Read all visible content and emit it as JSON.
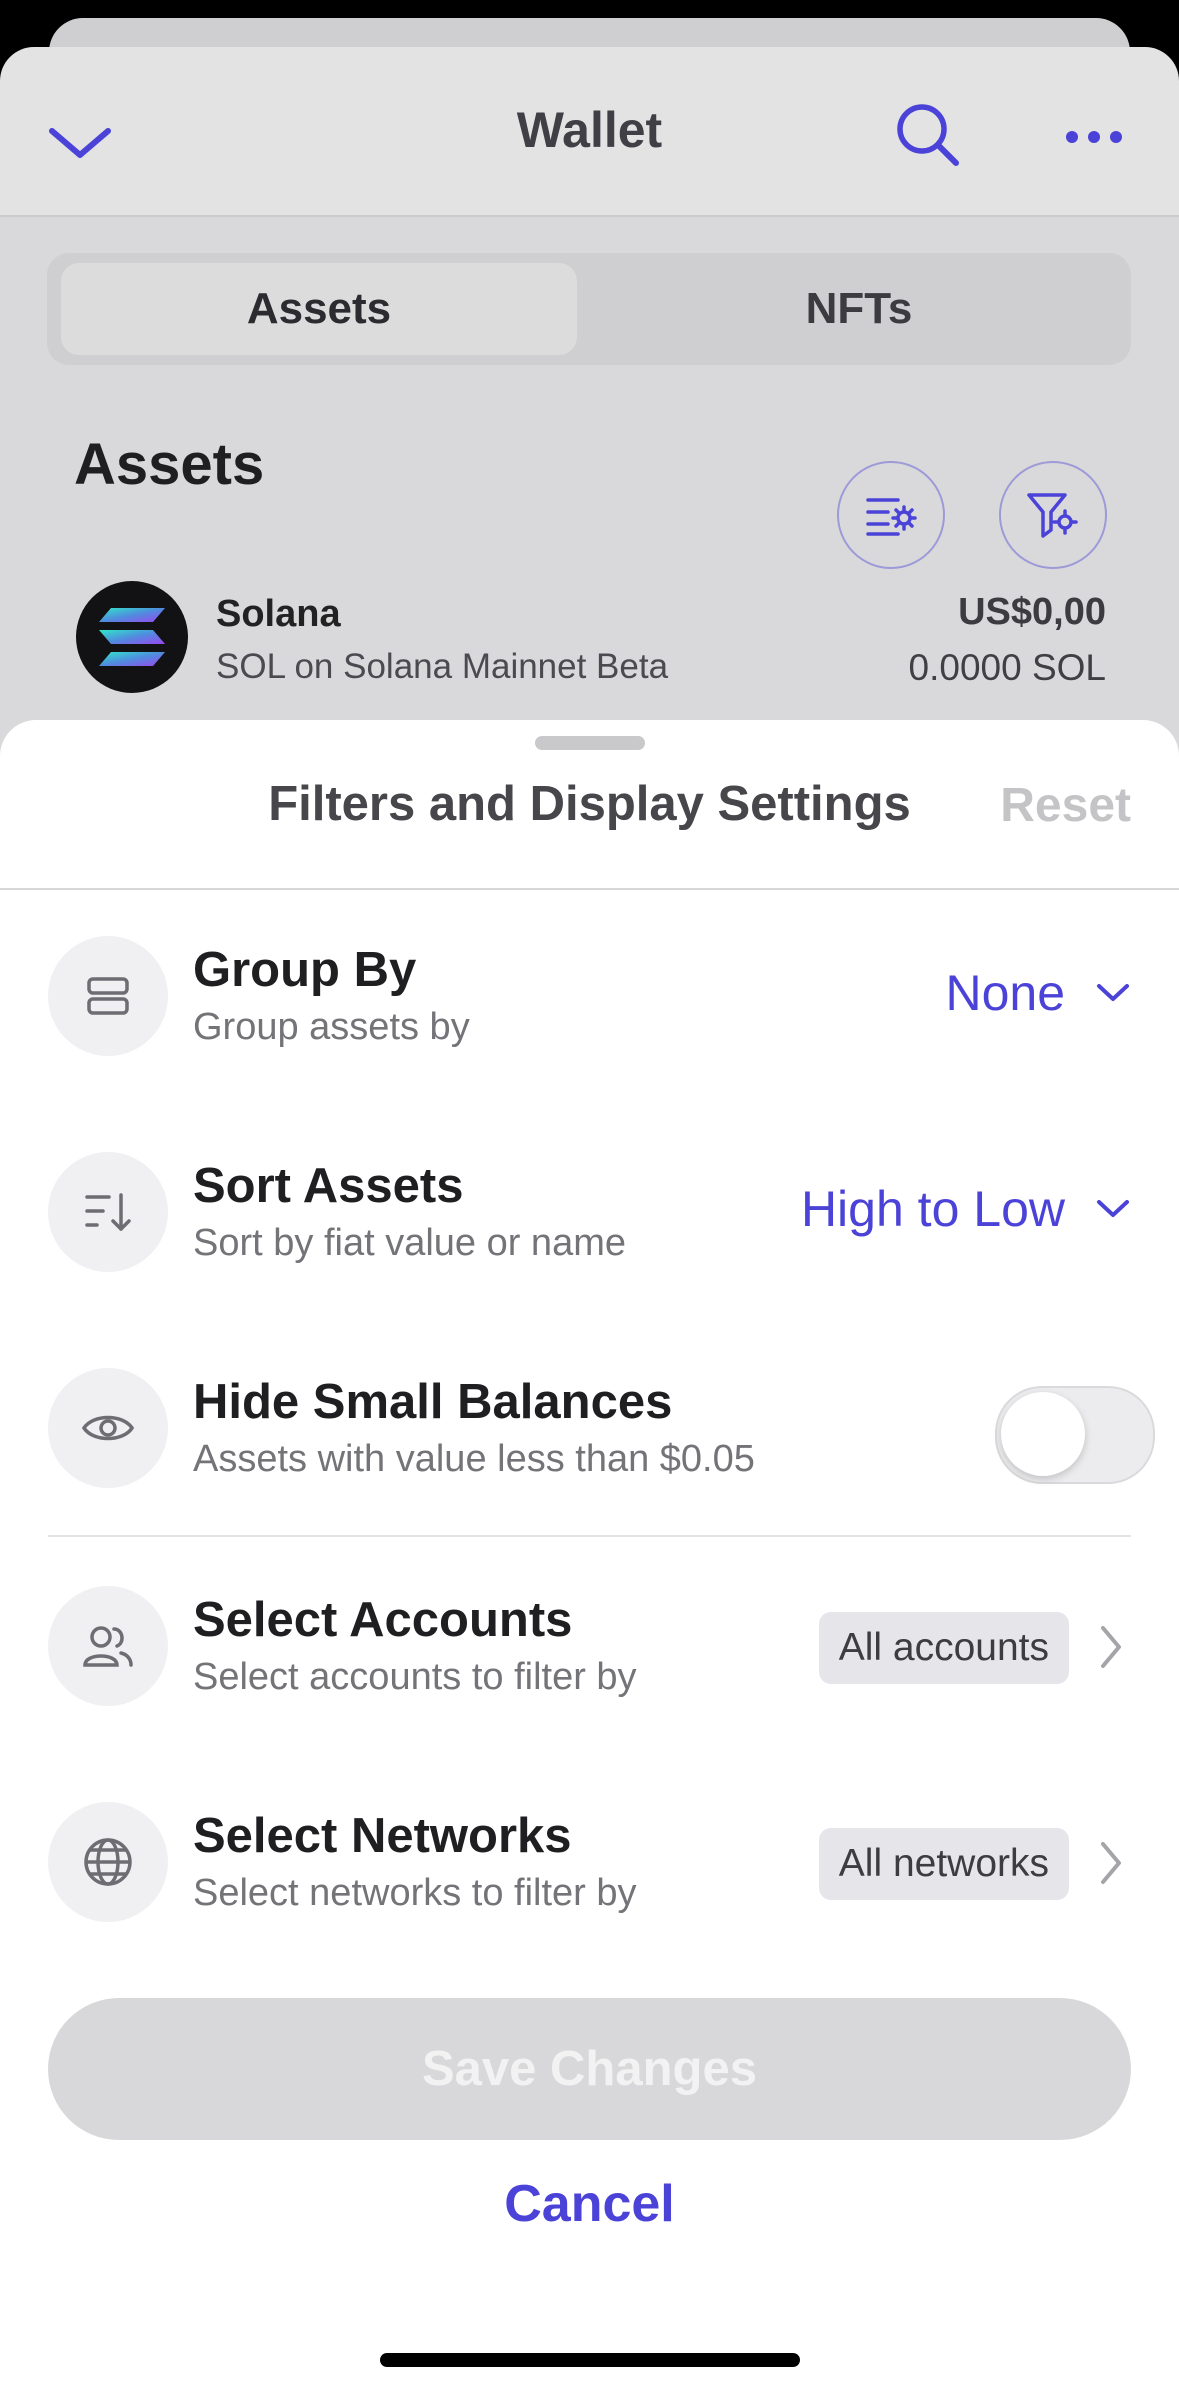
{
  "wallet": {
    "title": "Wallet",
    "tabs": [
      "Assets",
      "NFTs"
    ],
    "heading": "Assets",
    "asset": {
      "name": "Solana",
      "subtitle": "SOL on Solana Mainnet Beta",
      "fiat": "US$0,00",
      "amount": "0.0000 SOL"
    }
  },
  "sheet": {
    "title": "Filters and Display Settings",
    "reset_label": "Reset",
    "group_by": {
      "label": "Group By",
      "sub": "Group assets by",
      "value": "None"
    },
    "sort": {
      "label": "Sort Assets",
      "sub": "Sort by fiat value or name",
      "value": "High to Low"
    },
    "hide_small": {
      "label": "Hide Small Balances",
      "sub": "Assets with value less than $0.05",
      "enabled": false
    },
    "accounts": {
      "label": "Select Accounts",
      "sub": "Select accounts to filter by",
      "chip": "All accounts"
    },
    "networks": {
      "label": "Select Networks",
      "sub": "Select networks to filter by",
      "chip": "All networks"
    },
    "save_label": "Save Changes",
    "cancel_label": "Cancel"
  },
  "colors": {
    "accent": "#4b43d8",
    "disabled_button": "#d8d8da"
  }
}
